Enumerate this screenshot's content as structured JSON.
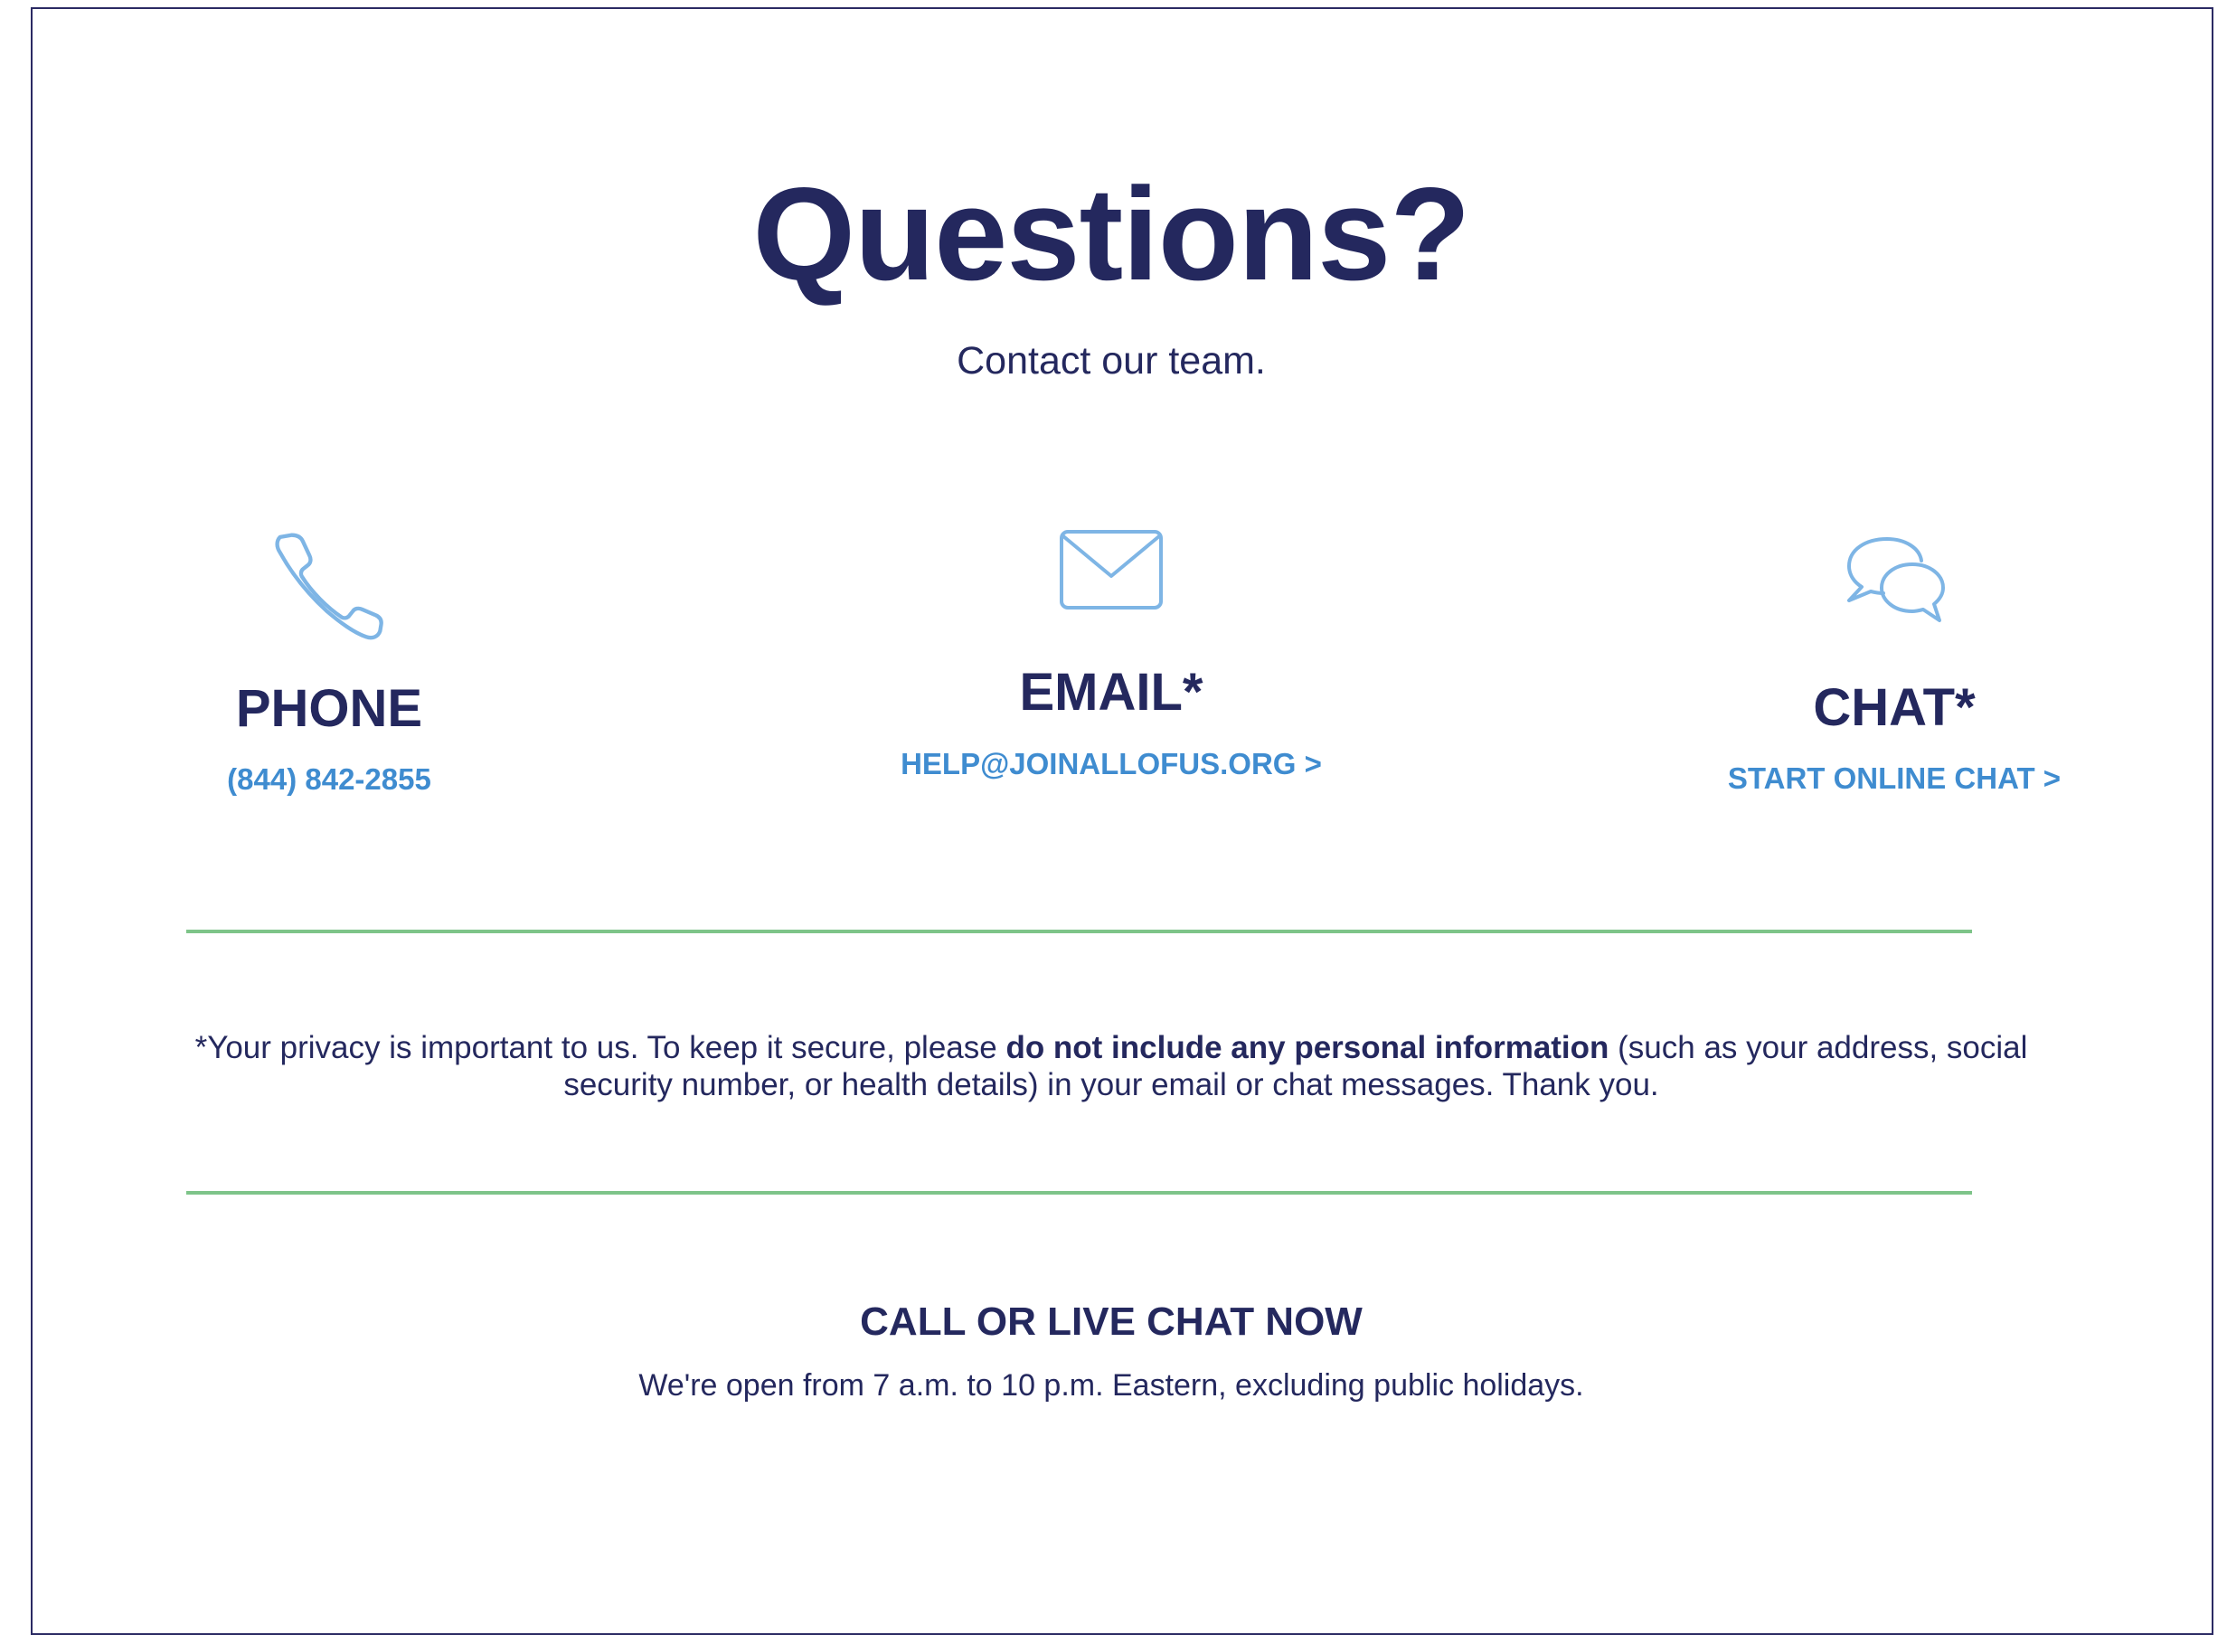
{
  "page": {
    "title": "Questions?",
    "subtitle": "Contact our team."
  },
  "channels": {
    "phone": {
      "icon": "phone-icon",
      "heading": "PHONE",
      "link": "(844) 842-2855"
    },
    "email": {
      "icon": "envelope-icon",
      "heading": "EMAIL*",
      "link": "HELP@JOINALLOFUS.ORG >"
    },
    "chat": {
      "icon": "chat-bubbles-icon",
      "heading": "CHAT*",
      "link": "START ONLINE CHAT >"
    }
  },
  "notice": {
    "before": "*Your privacy is important to us. To keep it secure, please ",
    "bold": "do not include any personal information",
    "after": " (such as your address, social security number, or health details) in your email or chat messages. Thank you."
  },
  "cta": {
    "title": "CALL OR LIVE CHAT NOW",
    "hours": "We're open from 7 a.m. to 10 p.m. Eastern, excluding public holidays."
  },
  "colors": {
    "navy": "#24285e",
    "link_blue": "#3f8cd0",
    "icon_blue": "#7eb5e5",
    "divider_green": "#7ec489"
  }
}
